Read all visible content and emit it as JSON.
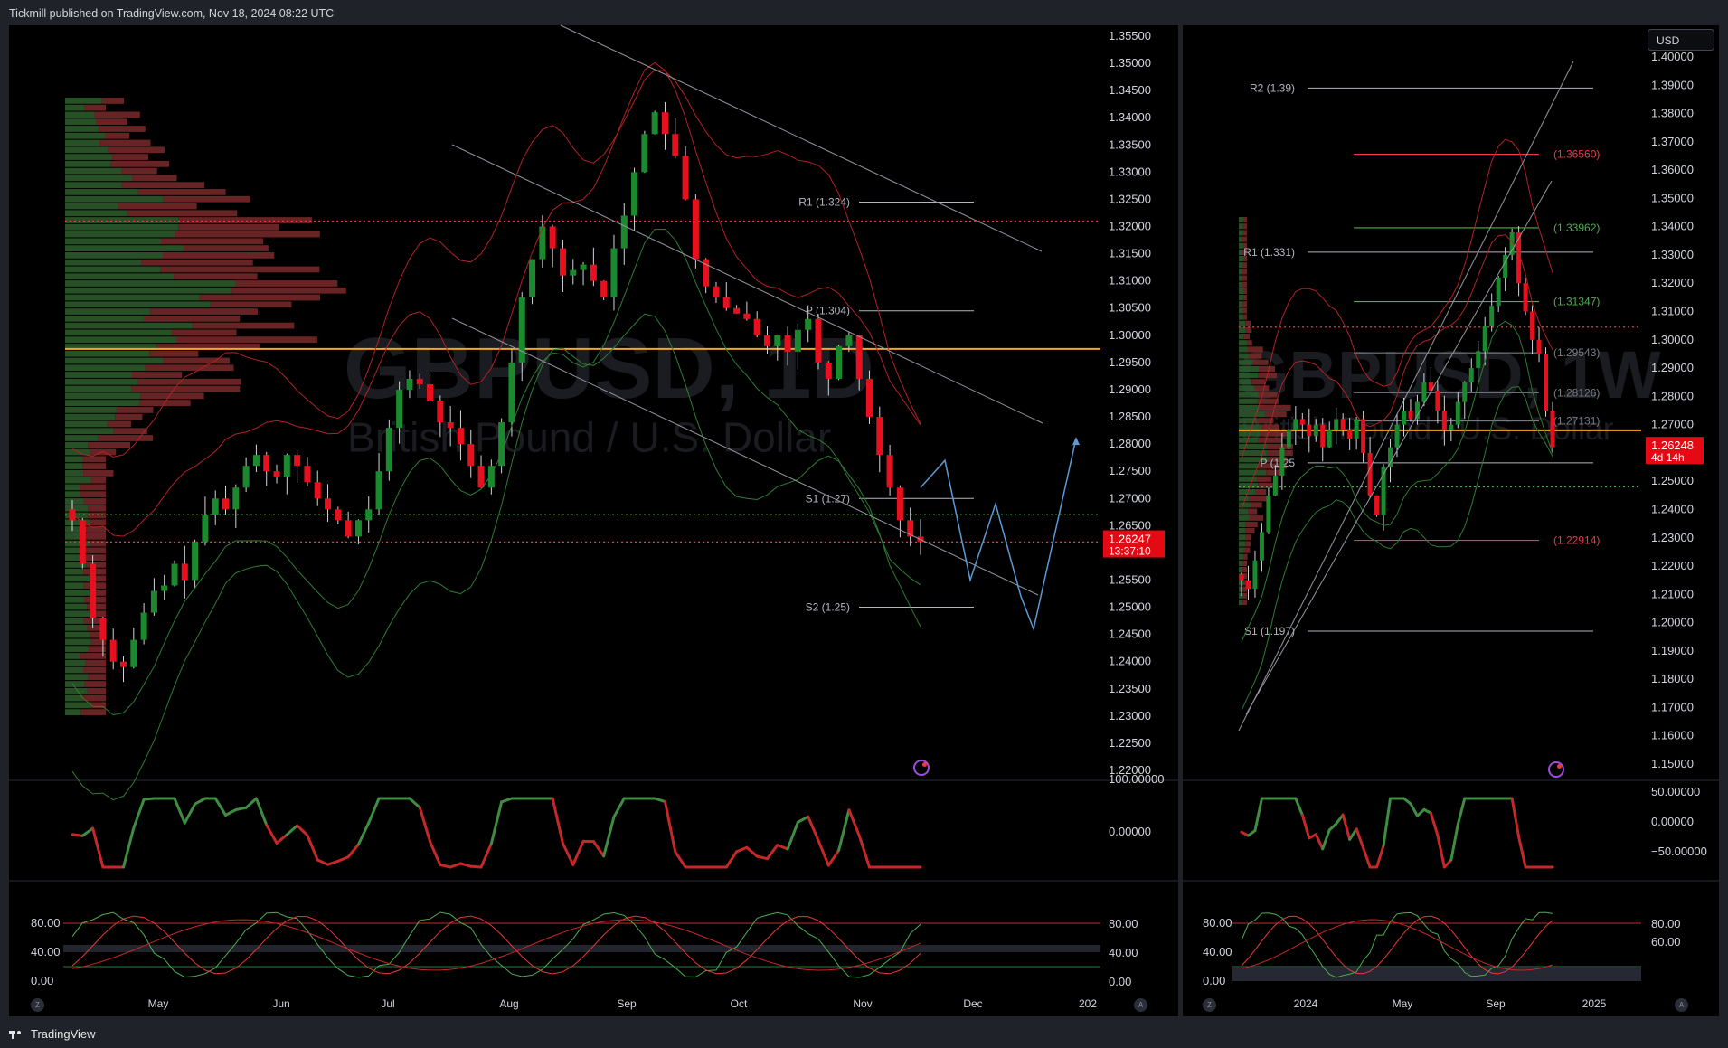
{
  "header": {
    "published": "Tickmill published on TradingView.com, Nov 18, 2024 08:22 UTC"
  },
  "footer": {
    "brand": "TradingView"
  },
  "currency_button": "USD",
  "chart_data": [
    {
      "type": "candlestick",
      "title": "GBPUSD, 1D",
      "subtitle": "British Pound / U.S. Dollar",
      "x_ticks": [
        "May",
        "Jun",
        "Jul",
        "Aug",
        "Sep",
        "Oct",
        "Nov",
        "Dec",
        "202"
      ],
      "y_ticks": [
        "1.35500",
        "1.35000",
        "1.34500",
        "1.34000",
        "1.33500",
        "1.33000",
        "1.32500",
        "1.32000",
        "1.31500",
        "1.31000",
        "1.30500",
        "1.30000",
        "1.29500",
        "1.29000",
        "1.28500",
        "1.28000",
        "1.27500",
        "1.27000",
        "1.26500",
        "1.26000",
        "1.25500",
        "1.25000",
        "1.24500",
        "1.24000",
        "1.23500",
        "1.23000",
        "1.22500",
        "1.22000"
      ],
      "ylim": [
        1.22,
        1.355
      ],
      "last_price": "1.26247",
      "countdown": "13:37:10",
      "pivot_labels": [
        "R1 (1.324)",
        "P (1.304)",
        "S1 (1.27)",
        "S2 (1.25)"
      ],
      "pivot_values": [
        1.3245,
        1.3045,
        1.27,
        1.25
      ],
      "horizontal_levels": [
        {
          "value": 1.2975,
          "style": "solid",
          "color": "#f5a623"
        },
        {
          "value": 1.321,
          "style": "dotted",
          "color": "#f23645"
        },
        {
          "value": 1.267,
          "style": "dotted",
          "color": "#4caf50"
        },
        {
          "value": 1.262,
          "style": "dotted",
          "color": "#f23645"
        }
      ],
      "close_path": [
        1.266,
        1.258,
        1.248,
        1.244,
        1.24,
        1.239,
        1.244,
        1.249,
        1.253,
        1.254,
        1.258,
        1.255,
        1.262,
        1.267,
        1.27,
        1.268,
        1.272,
        1.276,
        1.278,
        1.275,
        1.274,
        1.278,
        1.276,
        1.273,
        1.27,
        1.268,
        1.266,
        1.263,
        1.266,
        1.268,
        1.275,
        1.283,
        1.29,
        1.292,
        1.291,
        1.288,
        1.284,
        1.283,
        1.28,
        1.276,
        1.272,
        1.276,
        1.284,
        1.295,
        1.307,
        1.314,
        1.32,
        1.316,
        1.311,
        1.312,
        1.313,
        1.31,
        1.307,
        1.316,
        1.322,
        1.33,
        1.337,
        1.341,
        1.337,
        1.333,
        1.325,
        1.314,
        1.309,
        1.307,
        1.305,
        1.304,
        1.303,
        1.3,
        1.298,
        1.3,
        1.297,
        1.301,
        1.303,
        1.295,
        1.292,
        1.298,
        1.3,
        1.292,
        1.285,
        1.278,
        1.272,
        1.266,
        1.263,
        1.262
      ],
      "projection": [
        1.272,
        1.277,
        1.255,
        1.269,
        1.252,
        1.246,
        1.281
      ],
      "oscillator_ticks": [
        "100.00000",
        "0.00000"
      ],
      "stochastic_ticks": [
        "80.00",
        "40.00",
        "0.00"
      ],
      "stochastic_right_ticks": [
        "80.00",
        "40.00",
        "0.00"
      ]
    },
    {
      "type": "candlestick",
      "title": "GBPUSD, 1W",
      "subtitle": "British Pound / U.S. Dollar",
      "x_ticks": [
        "2024",
        "May",
        "Sep",
        "2025"
      ],
      "y_ticks": [
        "1.40000",
        "1.39000",
        "1.38000",
        "1.37000",
        "1.36000",
        "1.35000",
        "1.34000",
        "1.33000",
        "1.32000",
        "1.31000",
        "1.30000",
        "1.29000",
        "1.28000",
        "1.27000",
        "1.26000",
        "1.25000",
        "1.24000",
        "1.23000",
        "1.22000",
        "1.21000",
        "1.20000",
        "1.19000",
        "1.18000",
        "1.17000",
        "1.16000",
        "1.15000"
      ],
      "ylim": [
        1.15,
        1.4
      ],
      "last_price": "1.26248",
      "countdown": "4d 14h",
      "pivot_labels": [
        "R2 (1.39)",
        "R1 (1.331)",
        "P (1.25",
        "S1 (1.197)"
      ],
      "pivot_values": [
        1.389,
        1.331,
        1.2565,
        1.197
      ],
      "fib_labels": [
        "(1.36560)",
        "(1.33962)",
        "(1.31347)",
        "(1.29543)",
        "(1.28126)",
        "(1.27131)",
        "(1.22914)"
      ],
      "fib_values": [
        1.3656,
        1.3396,
        1.3135,
        1.2954,
        1.2813,
        1.2713,
        1.2291
      ],
      "horizontal_levels": [
        {
          "value": 1.268,
          "style": "solid",
          "color": "#f5a623"
        },
        {
          "value": 1.3045,
          "style": "dotted",
          "color": "#f23645"
        },
        {
          "value": 1.248,
          "style": "dotted",
          "color": "#4caf50"
        }
      ],
      "close_path": [
        1.215,
        1.212,
        1.222,
        1.232,
        1.245,
        1.252,
        1.262,
        1.268,
        1.272,
        1.27,
        1.266,
        1.27,
        1.262,
        1.268,
        1.272,
        1.268,
        1.265,
        1.272,
        1.26,
        1.245,
        1.238,
        1.255,
        1.262,
        1.27,
        1.275,
        1.272,
        1.278,
        1.285,
        1.282,
        1.275,
        1.268,
        1.27,
        1.278,
        1.285,
        1.29,
        1.296,
        1.305,
        1.312,
        1.322,
        1.33,
        1.338,
        1.32,
        1.31,
        1.3,
        1.295,
        1.275,
        1.262
      ],
      "oscillator_ticks": [
        "50.00000",
        "0.00000",
        "−50.00000"
      ],
      "stochastic_ticks": [
        "80.00",
        "40.00",
        "0.00"
      ],
      "stochastic_right_ticks": [
        "80.00",
        "60.00"
      ]
    }
  ],
  "colors": {
    "bull": "#26a69a",
    "bullGreen": "#2e7d32",
    "bear": "#f23645",
    "orange": "#f5a623",
    "blue": "#5b9bd5"
  }
}
